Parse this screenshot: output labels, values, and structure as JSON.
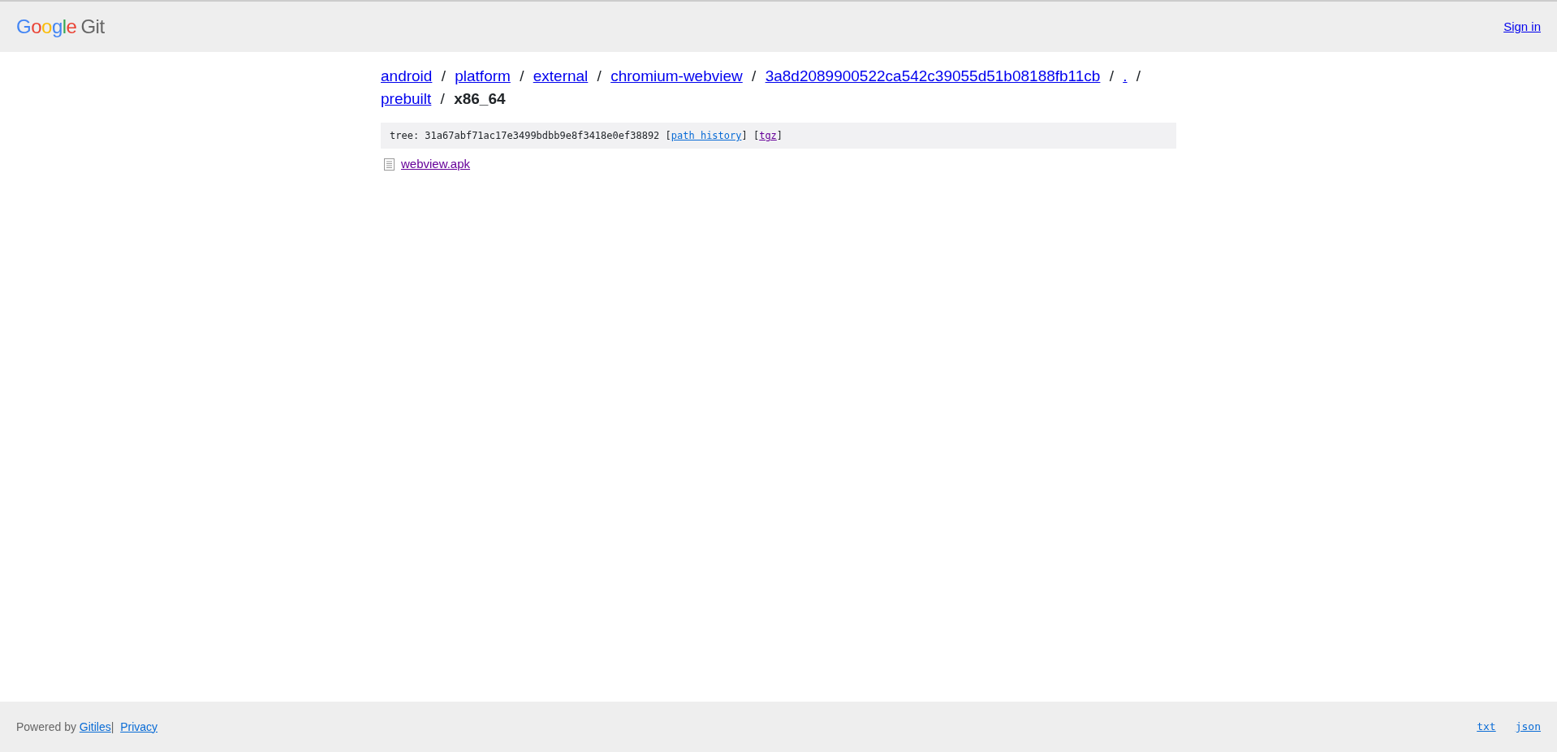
{
  "header": {
    "logo": {
      "brand": "Google",
      "product": "Git"
    },
    "sign_in": "Sign in"
  },
  "breadcrumb": [
    {
      "kind": "link",
      "text": "android"
    },
    {
      "kind": "sep",
      "text": "/"
    },
    {
      "kind": "link",
      "text": "platform"
    },
    {
      "kind": "sep",
      "text": "/"
    },
    {
      "kind": "link",
      "text": "external"
    },
    {
      "kind": "sep",
      "text": "/"
    },
    {
      "kind": "link",
      "text": "chromium-webview"
    },
    {
      "kind": "sep",
      "text": "/"
    },
    {
      "kind": "link",
      "text": "3a8d2089900522ca542c39055d51b08188fb11cb"
    },
    {
      "kind": "sep",
      "text": "/"
    },
    {
      "kind": "link",
      "text": "."
    },
    {
      "kind": "sep",
      "text": "/"
    },
    {
      "kind": "link",
      "text": "prebuilt"
    },
    {
      "kind": "sep",
      "text": "/"
    },
    {
      "kind": "current",
      "text": "x86_64"
    }
  ],
  "tree_line": [
    {
      "kind": "text",
      "text": "tree: 31a67abf71ac17e3499bdbb9e8f3418e0ef38892 ["
    },
    {
      "kind": "link",
      "text": "path history"
    },
    {
      "kind": "text",
      "text": "] ["
    },
    {
      "kind": "visited",
      "text": "tgz"
    },
    {
      "kind": "text",
      "text": "]"
    }
  ],
  "files": [
    {
      "name": "webview.apk"
    }
  ],
  "footer": {
    "powered_by": "Powered by",
    "gitiles": "Gitiles",
    "separator": "|",
    "privacy": "Privacy",
    "formats": [
      "txt",
      "json"
    ]
  }
}
